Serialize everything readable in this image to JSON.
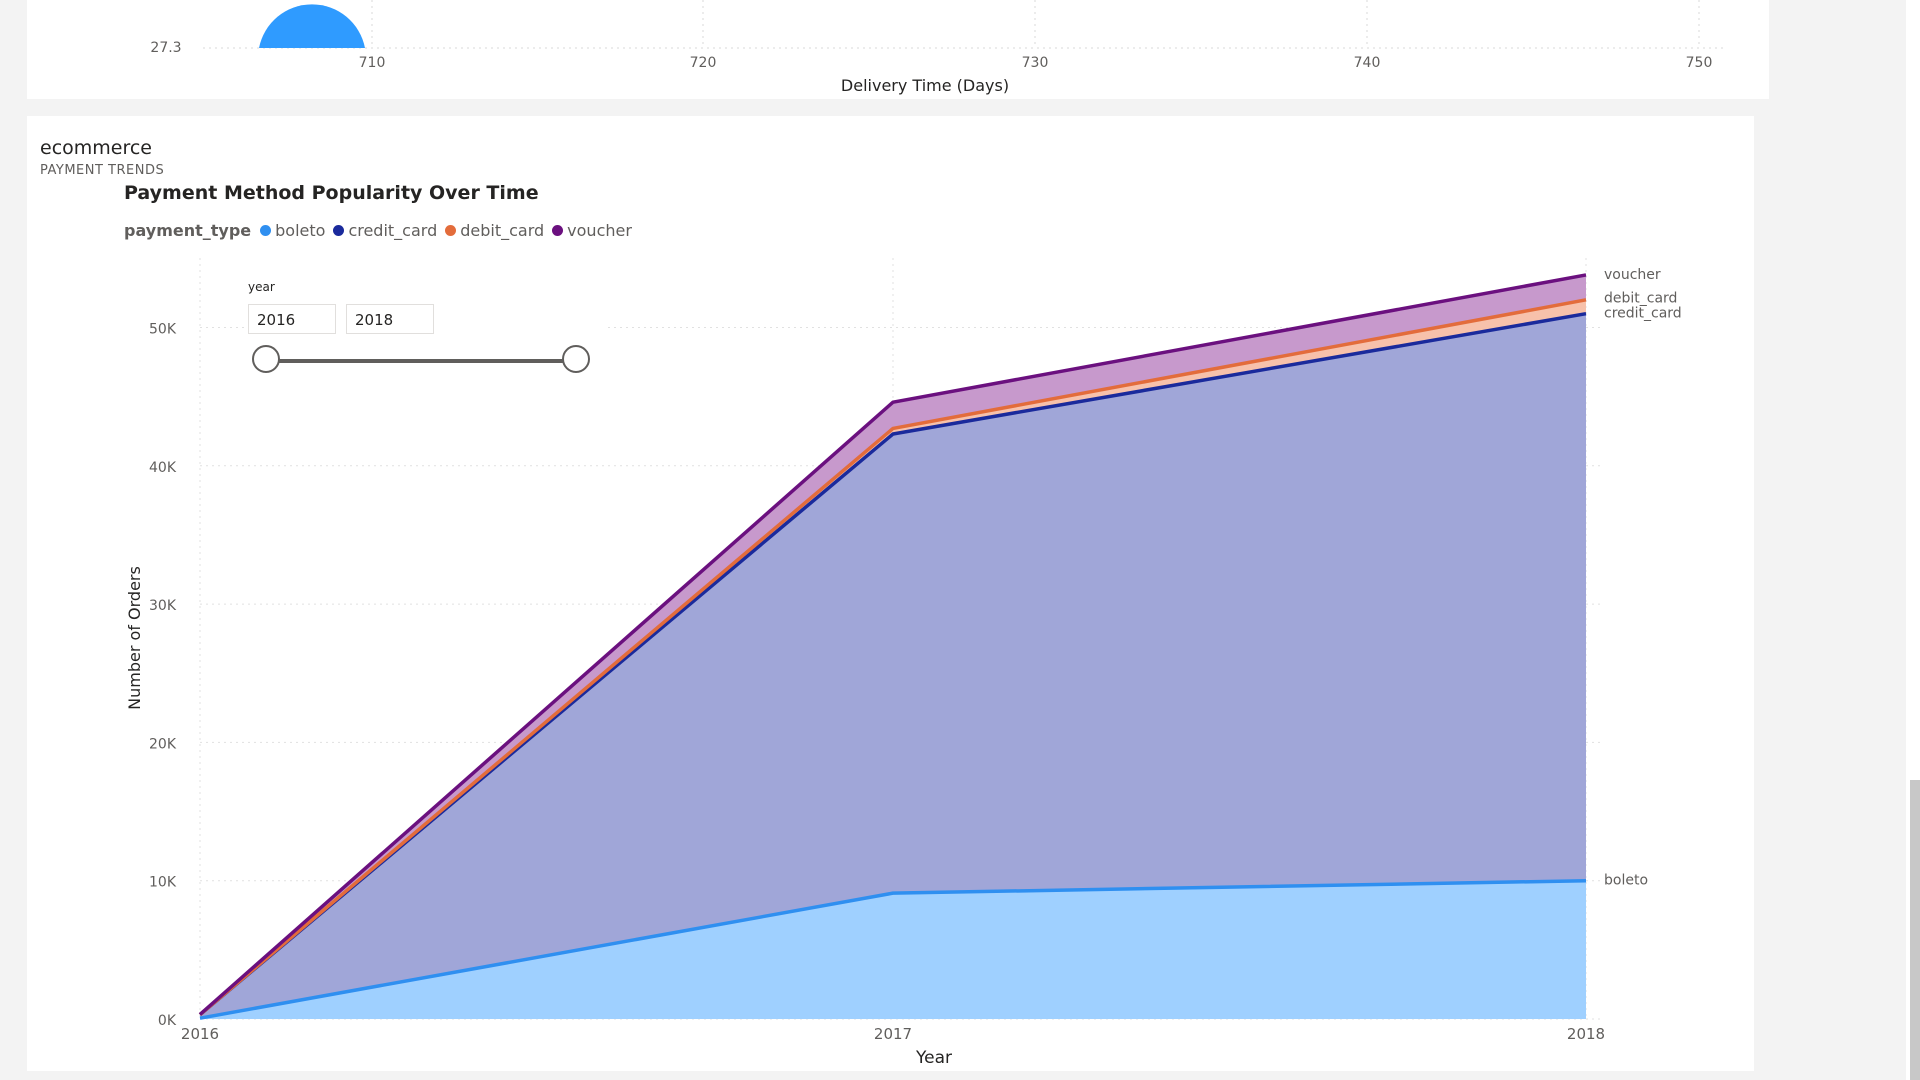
{
  "top_chart": {
    "y_tick": "27.3",
    "x_ticks": [
      "710",
      "720",
      "730",
      "740",
      "750"
    ],
    "xlabel": "Delivery Time (Days)",
    "bubble_color": "#2f9bff"
  },
  "report": {
    "name": "ecommerce",
    "page_subtitle": "PAYMENT TRENDS"
  },
  "slicer": {
    "title": "year",
    "from": "2016",
    "to": "2018"
  },
  "legend": {
    "title": "payment_type"
  },
  "chart_data": {
    "type": "area",
    "stacked": true,
    "title": "Payment Method Popularity Over Time",
    "xlabel": "Year",
    "ylabel": "Number of Orders",
    "x": [
      "2016",
      "2017",
      "2018"
    ],
    "ylim": [
      0,
      55000
    ],
    "y_ticks": [
      "0K",
      "10K",
      "20K",
      "30K",
      "40K",
      "50K"
    ],
    "grid": true,
    "legend_position": "top-left",
    "series": [
      {
        "name": "boleto",
        "color": "#2f8ff0",
        "fill": "#9fd0ff",
        "values": [
          60,
          9100,
          10000
        ]
      },
      {
        "name": "credit_card",
        "color": "#1a2a9c",
        "fill": "#a0a6d8",
        "values": [
          250,
          33200,
          41000
        ]
      },
      {
        "name": "debit_card",
        "color": "#e36c3b",
        "fill": "#f7c1ab",
        "values": [
          5,
          400,
          1000
        ]
      },
      {
        "name": "voucher",
        "color": "#6b107f",
        "fill": "#c799cc",
        "values": [
          15,
          1900,
          1800
        ]
      }
    ]
  }
}
